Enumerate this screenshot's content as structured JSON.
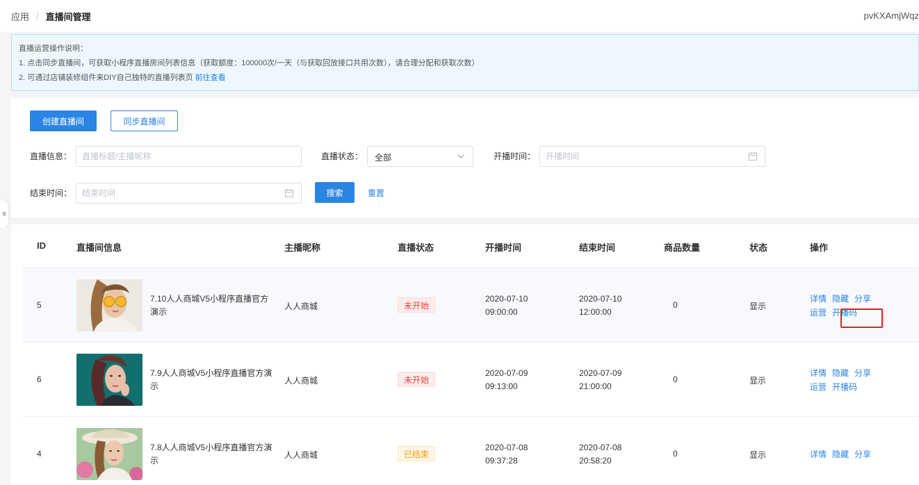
{
  "breadcrumb": {
    "root": "应用",
    "current": "直播间管理"
  },
  "user": {
    "name": "pvKXAmjWqz"
  },
  "notice": {
    "heading": "直播运营操作说明：",
    "line1": "1. 点击同步直播间，可获取小程序直播房间列表信息（获取额度：100000次/一天（与获取回放接口共用次数），请合理分配和获取次数）",
    "line2": "2. 可通过店铺装修组件来DIY自己独特的直播列表页",
    "line2_link": "前往查看"
  },
  "actions": {
    "create": "创建直播间",
    "sync": "同步直播间"
  },
  "filters": {
    "info_label": "直播信息：",
    "info_placeholder": "直播标题/主播昵称",
    "status_label": "直播状态：",
    "status_value": "全部",
    "start_label": "开播时间：",
    "start_placeholder": "开播时间",
    "end_label": "结束时间：",
    "end_placeholder": "结束时间",
    "search": "搜索",
    "reset": "重置"
  },
  "table": {
    "columns": [
      "ID",
      "直播间信息",
      "主播昵称",
      "直播状态",
      "开播时间",
      "结束时间",
      "商品数量",
      "状态",
      "操作"
    ],
    "rows": [
      {
        "id": "5",
        "title": "7.10人人商城V5小程序直播官方演示",
        "anchor": "人人商城",
        "live_status": "未开始",
        "start_date": "2020-07-10",
        "start_time": "09:00:00",
        "end_date": "2020-07-10",
        "end_time": "12:00:00",
        "goods": "0",
        "state": "显示",
        "ops1": [
          "详情",
          "隐藏",
          "分享"
        ],
        "ops2": [
          "运营",
          "开播码"
        ]
      },
      {
        "id": "6",
        "title": "7.9人人商城V5小程序直播官方演示",
        "anchor": "人人商城",
        "live_status": "未开始",
        "start_date": "2020-07-09",
        "start_time": "09:13:00",
        "end_date": "2020-07-09",
        "end_time": "21:00:00",
        "goods": "0",
        "state": "显示",
        "ops1": [
          "详情",
          "隐藏",
          "分享"
        ],
        "ops2": [
          "运营",
          "开播码"
        ]
      },
      {
        "id": "4",
        "title": "7.8人人商城V5小程序直播官方演示",
        "anchor": "人人商城",
        "live_status": "已结束",
        "start_date": "2020-07-08",
        "start_time": "09:37:28",
        "end_date": "2020-07-08",
        "end_time": "20:58:20",
        "goods": "0",
        "state": "显示",
        "ops1": [
          "详情",
          "隐藏",
          "分享"
        ]
      }
    ]
  },
  "colors": {
    "primary": "#2b85e4",
    "pending": "#ef3f3f",
    "ended": "#f29b12",
    "highlight": "#e02020"
  }
}
